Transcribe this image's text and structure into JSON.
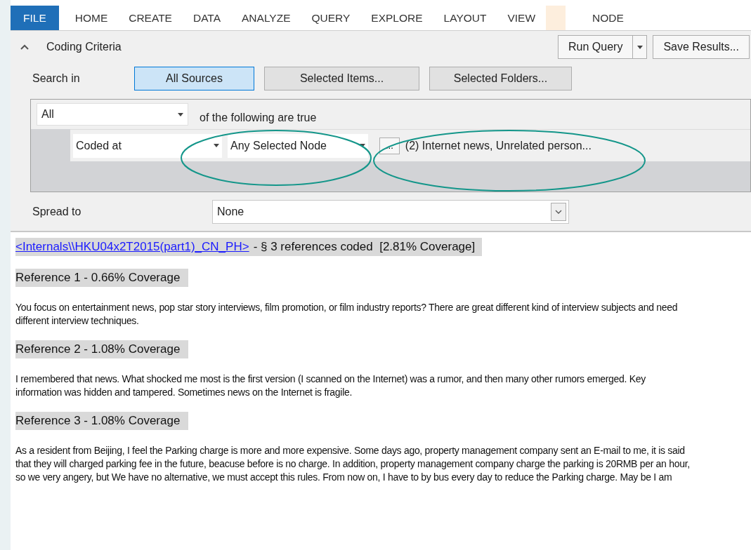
{
  "tabs": [
    {
      "label": "FILE",
      "selected": true,
      "contextual": false
    },
    {
      "label": "HOME",
      "selected": false,
      "contextual": false
    },
    {
      "label": "CREATE",
      "selected": false,
      "contextual": false
    },
    {
      "label": "DATA",
      "selected": false,
      "contextual": false
    },
    {
      "label": "ANALYZE",
      "selected": false,
      "contextual": false
    },
    {
      "label": "QUERY",
      "selected": false,
      "contextual": false
    },
    {
      "label": "EXPLORE",
      "selected": false,
      "contextual": false
    },
    {
      "label": "LAYOUT",
      "selected": false,
      "contextual": false
    },
    {
      "label": "VIEW",
      "selected": false,
      "contextual": false
    },
    {
      "label": "NODE",
      "selected": false,
      "contextual": true
    }
  ],
  "criteria": {
    "title": "Coding Criteria",
    "expanded": true,
    "run_button": "Run Query",
    "save_button": "Save Results...",
    "search_in": {
      "label": "Search in",
      "options": [
        {
          "label": "All Sources",
          "selected": true
        },
        {
          "label": "Selected Items...",
          "selected": false
        },
        {
          "label": "Selected Folders...",
          "selected": false
        }
      ]
    },
    "match": {
      "value": "All",
      "text": "of the following are true"
    },
    "condition": {
      "field": "Coded at",
      "operator": "Any Selected Node",
      "browse": "...",
      "nodes": "(2) Internet news, Unrelated person..."
    },
    "spread_to": {
      "label": "Spread to",
      "value": "None"
    }
  },
  "results": {
    "source_link": "<Internals\\\\HKU04x2T2015(part1)_CN_PH>",
    "summary": "- § 3 references coded  [2.81% Coverage]",
    "references": [
      {
        "heading": "Reference 1 - 0.66% Coverage",
        "text": "You focus on entertainment news, pop star story interviews, film promotion, or film industry reports? There are great different kind of interview subjects and need different interview techniques."
      },
      {
        "heading": "Reference 2 - 1.08% Coverage",
        "text": "I remembered that news. What shocked me most is the first version (I scanned on the Internet) was a rumor, and then many other rumors emerged. Key information was hidden and tampered. Sometimes news on the Internet is fragile."
      },
      {
        "heading": "Reference 3 - 1.08% Coverage",
        "text": "As a resident from Beijing, I feel the Parking charge is more and more expensive. Some days ago, property management company sent an E-mail to me, it is said that they will charged parking fee in the future, beacuse before is no charge. In addition, property management company charge the parking is 20RMB per an hour, so we very angery, but We have no alternative, we must accept this rules. From now on, I have to by bus every day to reduce the Parking charge. May be I am"
      }
    ]
  }
}
